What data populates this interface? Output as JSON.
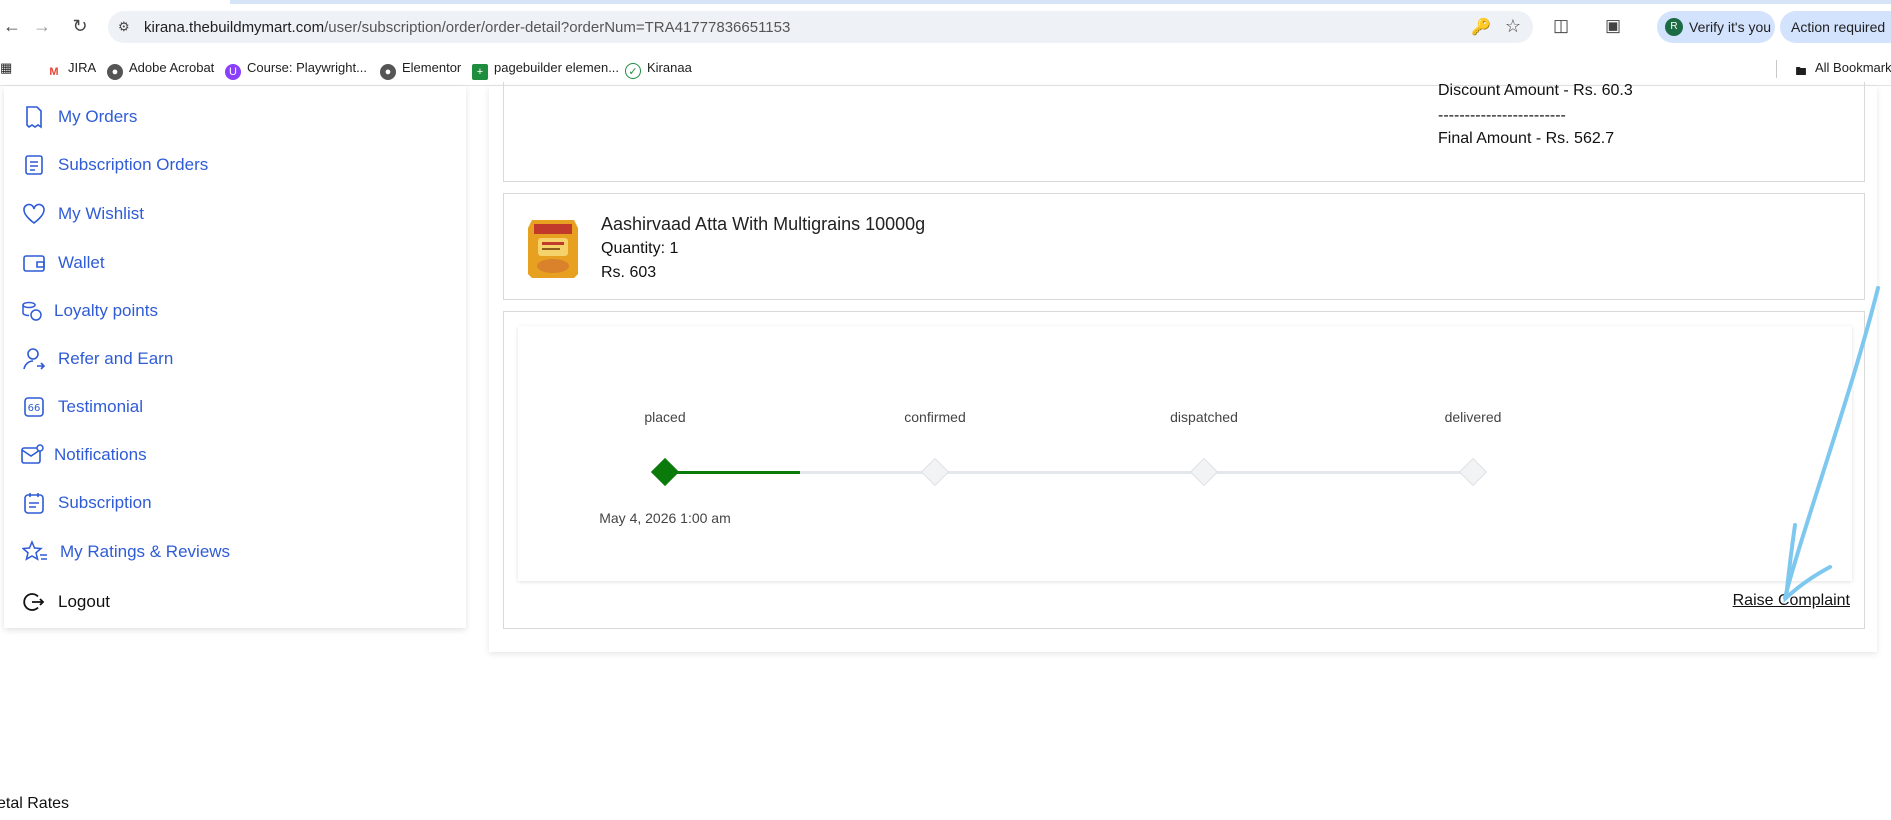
{
  "browser": {
    "url_host": "kirana.thebuildmymart.com",
    "url_path": "/user/subscription/order/order-detail?orderNum=TRA41777836651153",
    "verify_label": "Verify it's you",
    "avatar_letter": "R",
    "action_label": "Action required"
  },
  "bookmarks": {
    "items": [
      {
        "label": "JIRA",
        "icon": "gmail-icon"
      },
      {
        "label": "Adobe Acrobat",
        "icon": "globe-icon"
      },
      {
        "label": "Course: Playwright...",
        "icon": "course-icon"
      },
      {
        "label": "Elementor",
        "icon": "globe-icon"
      },
      {
        "label": "pagebuilder elemen...",
        "icon": "sheets-icon"
      },
      {
        "label": "Kiranaa",
        "icon": "check-icon"
      }
    ],
    "all_label": "All Bookmarks"
  },
  "sidebar": {
    "items": [
      {
        "label": "My Orders",
        "icon": "orders-icon"
      },
      {
        "label": "Subscription Orders",
        "icon": "subscription-orders-icon"
      },
      {
        "label": "My Wishlist",
        "icon": "heart-icon"
      },
      {
        "label": "Wallet",
        "icon": "wallet-icon"
      },
      {
        "label": "Loyalty points",
        "icon": "coins-icon"
      },
      {
        "label": "Refer and Earn",
        "icon": "refer-icon"
      },
      {
        "label": "Testimonial",
        "icon": "quote-icon"
      },
      {
        "label": "Notifications",
        "icon": "mail-icon"
      },
      {
        "label": "Subscription",
        "icon": "calendar-icon"
      },
      {
        "label": "My Ratings & Reviews",
        "icon": "star-list-icon"
      },
      {
        "label": "Logout",
        "icon": "logout-icon"
      }
    ]
  },
  "summary": {
    "discount": "Discount Amount - Rs. 60.3",
    "separator": "------------------------",
    "final": "Final Amount - Rs. 562.7"
  },
  "product": {
    "name": "Aashirvaad Atta With Multigrains 10000g",
    "quantity": "Quantity: 1",
    "price": "Rs. 603"
  },
  "tracker": {
    "stages": [
      "placed",
      "confirmed",
      "dispatched",
      "delivered"
    ],
    "current_stage": "placed",
    "placed_date": "May 4, 2026 1:00 am",
    "active_color": "#0a7a0a",
    "inactive_color": "#e4e7ec"
  },
  "complaint_label": "Raise Complaint",
  "footer_text": "etal Rates"
}
